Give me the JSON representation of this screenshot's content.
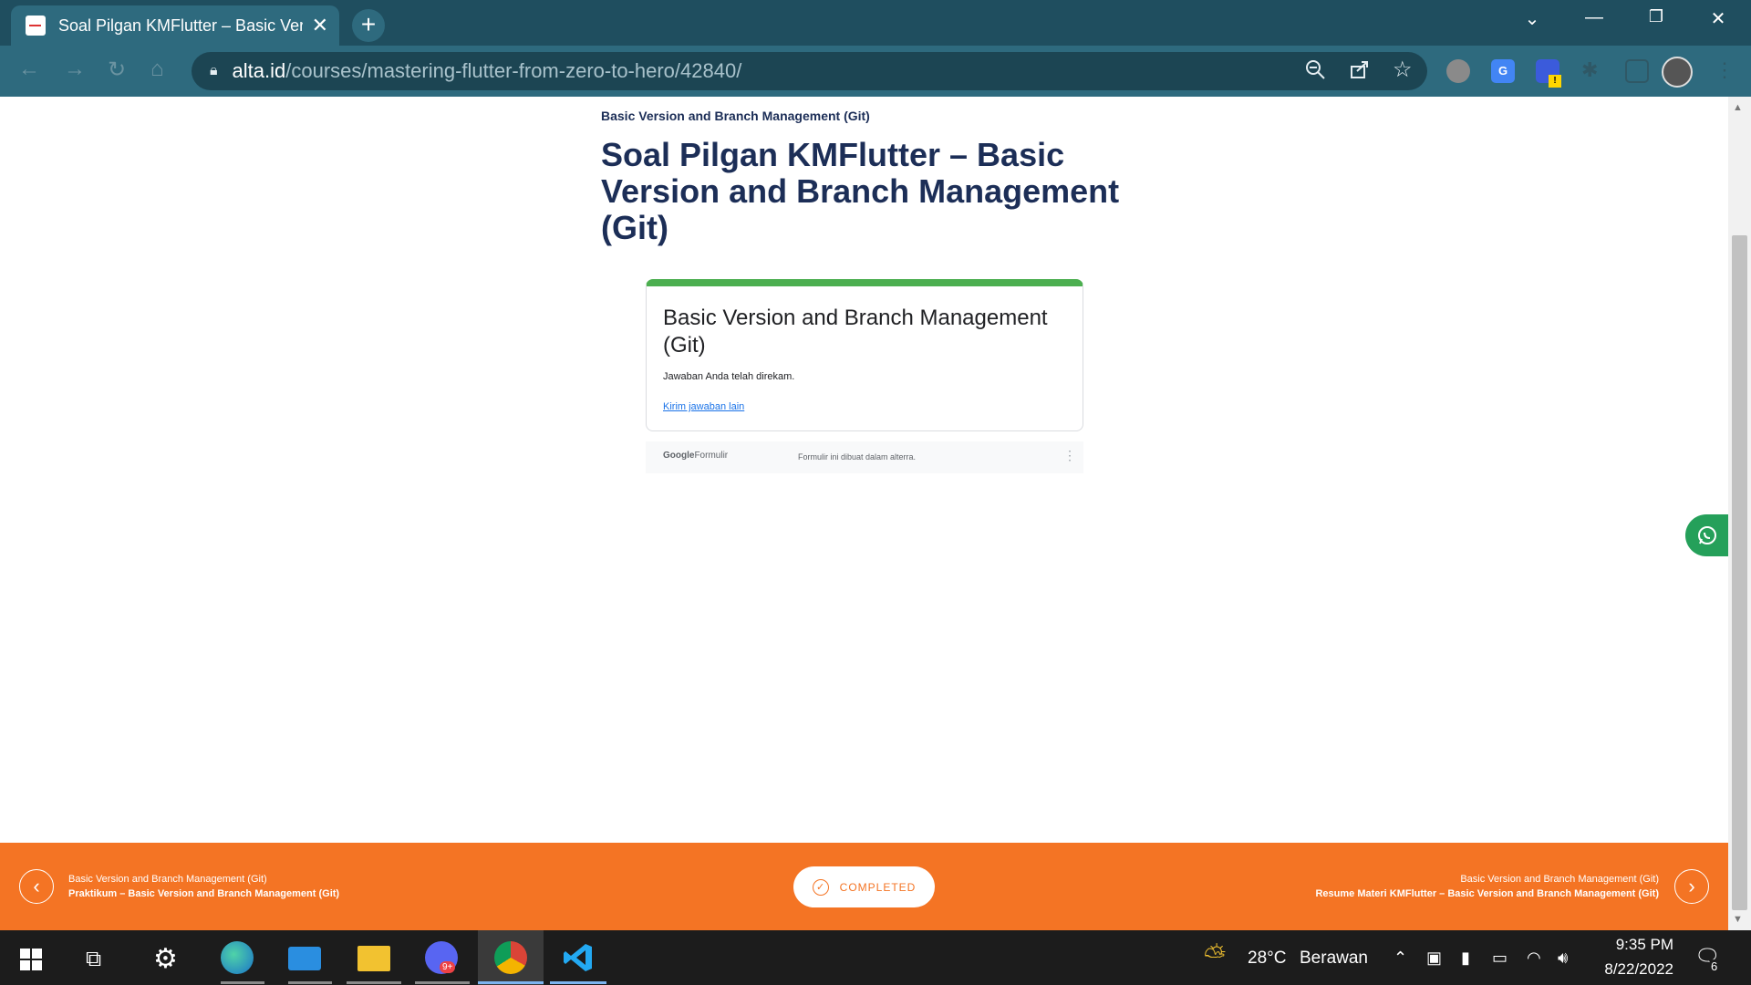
{
  "browser": {
    "tab_title": "Soal Pilgan KMFlutter – Basic Ver",
    "tab_close": "✕",
    "new_tab": "+",
    "url_host": "alta.id",
    "url_path": "/courses/mastering-flutter-from-zero-to-hero/42840/"
  },
  "page": {
    "breadcrumb": "Basic Version and Branch Management (Git)",
    "title": "Soal Pilgan KMFlutter – Basic Version and Branch Management (Git)"
  },
  "form": {
    "title": "Basic Version and Branch Management (Git)",
    "response": "Jawaban Anda telah direkam.",
    "link": "Kirim jawaban lain",
    "footer_logo_google": "Google",
    "footer_logo_formulir": "Formulir",
    "footer_note": "Formulir ini dibuat dalam alterra."
  },
  "course_nav": {
    "prev_section": "Basic Version and Branch Management (Git)",
    "prev_title": "Praktikum – Basic Version and Branch Management (Git)",
    "completed_label": "COMPLETED",
    "next_section": "Basic Version and Branch Management (Git)",
    "next_title": "Resume Materi KMFlutter – Basic Version and Branch Management (Git)"
  },
  "taskbar": {
    "weather_temp": "28°C",
    "weather_condition": "Berawan",
    "time": "9:35 PM",
    "date": "8/22/2022",
    "notification_count": "6",
    "discord_badge": "9+"
  },
  "colors": {
    "accent_orange": "#f47424",
    "title_navy": "#1c2e57",
    "form_green": "#4caf50",
    "chrome_teal": "#2e6a7e"
  }
}
